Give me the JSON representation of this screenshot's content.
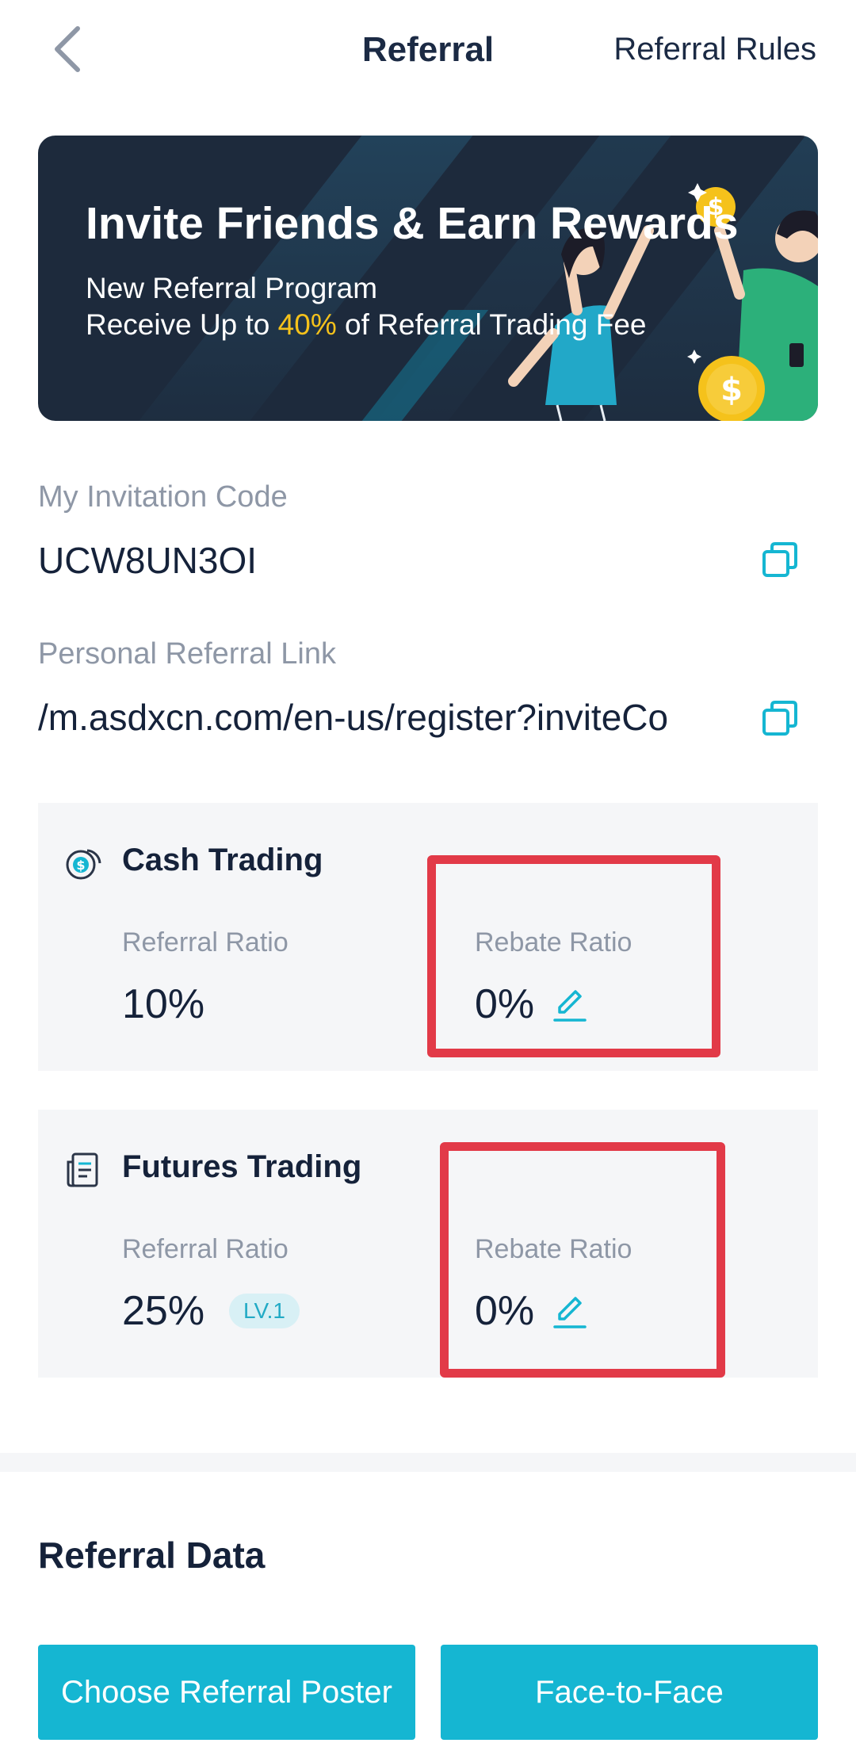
{
  "header": {
    "title": "Referral",
    "rules_label": "Referral Rules"
  },
  "banner": {
    "title": "Invite Friends & Earn Rewards",
    "subtitle": "New Referral Program",
    "line2_prefix": "Receive Up to ",
    "line2_highlight": "40%",
    "line2_suffix": " of Referral Trading Fee"
  },
  "invitation": {
    "label": "My Invitation Code",
    "code": "UCW8UN3OI"
  },
  "referral_link": {
    "label": "Personal Referral Link",
    "value": "/m.asdxcn.com/en-us/register?inviteCo"
  },
  "cash_trading": {
    "title": "Cash Trading",
    "referral_ratio_label": "Referral Ratio",
    "referral_ratio": "10%",
    "rebate_ratio_label": "Rebate Ratio",
    "rebate_ratio": "0%"
  },
  "futures_trading": {
    "title": "Futures Trading",
    "referral_ratio_label": "Referral Ratio",
    "referral_ratio": "25%",
    "level_badge": "LV.1",
    "rebate_ratio_label": "Rebate Ratio",
    "rebate_ratio": "0%"
  },
  "referral_data": {
    "title": "Referral Data"
  },
  "buttons": {
    "poster": "Choose Referral Poster",
    "face_to_face": "Face-to-Face"
  },
  "colors": {
    "accent": "#15b6d2",
    "highlight": "#f5c21b",
    "annotation": "#e23a48"
  },
  "icons": [
    "back-arrow-icon",
    "copy-icon",
    "coin-dollar-icon",
    "document-list-icon",
    "edit-pencil-icon"
  ]
}
